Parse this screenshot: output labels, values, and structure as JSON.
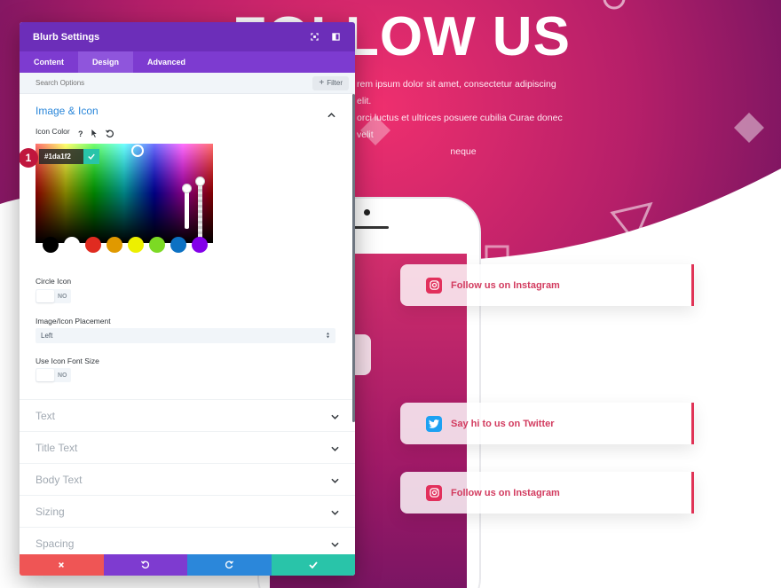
{
  "background": {
    "hero_title": "FOLLOW US",
    "hero_text_lines": [
      "rem ipsum dolor sit amet, consectetur adipiscing elit.",
      "orci luctus et ultrices posuere cubilia Curae donec velit",
      "neque"
    ],
    "social_buttons": [
      {
        "label": "Follow us on Instagram",
        "icon": "instagram-icon"
      },
      {
        "label": "Say hi to us on Twitter",
        "icon": "twitter-icon"
      },
      {
        "label": "Follow us on Instagram",
        "icon": "instagram-icon"
      }
    ],
    "colors": {
      "hero_pink": "#ee2f6e",
      "hero_purple": "#7a1563",
      "button_accent": "#e03356"
    }
  },
  "panel": {
    "title": "Blurb Settings",
    "tabs": [
      "Content",
      "Design",
      "Advanced"
    ],
    "active_tab": "Design",
    "search": {
      "placeholder": "Search Options",
      "filter_label": "Filter"
    },
    "section": {
      "title": "Image & Icon",
      "icon_color_label": "Icon Color",
      "color_picker": {
        "hex": "#1da1f2",
        "marker": "1"
      },
      "swatches": [
        "#000000",
        "#ffffff",
        "#e02b20",
        "#e09900",
        "#edf000",
        "#7cda24",
        "#0c71c3",
        "#8300e9"
      ],
      "circle_icon": {
        "label": "Circle Icon",
        "value": "NO"
      },
      "placement": {
        "label": "Image/Icon Placement",
        "value": "Left"
      },
      "use_icon_font_size": {
        "label": "Use Icon Font Size",
        "value": "NO"
      }
    },
    "collapsed_sections": [
      "Text",
      "Title Text",
      "Body Text",
      "Sizing",
      "Spacing"
    ],
    "colors": {
      "header": "#6c2eb9",
      "tabs": "#7d3bd0",
      "accent_blue": "#2b87da",
      "close": "#ef5555",
      "save": "#29c4a9"
    }
  }
}
